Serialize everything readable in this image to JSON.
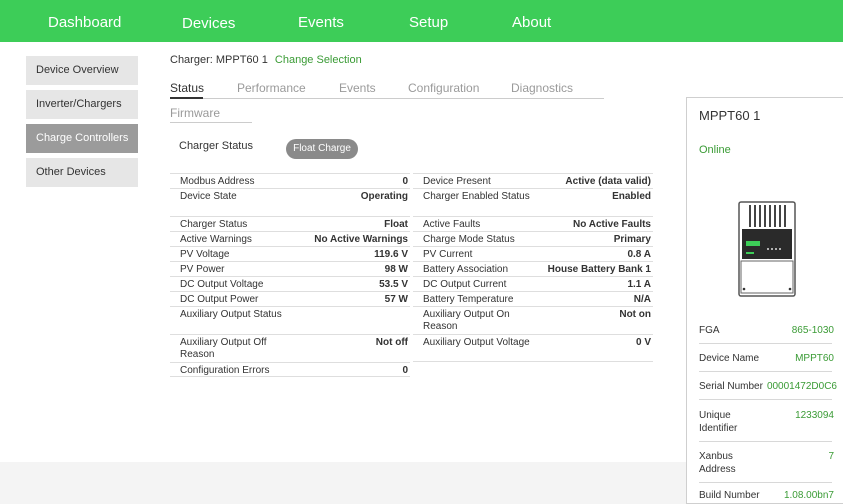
{
  "nav": [
    "Dashboard",
    "Devices",
    "Events",
    "Setup",
    "About"
  ],
  "nav_active": "Devices",
  "sidebar": [
    {
      "label": "Device Overview"
    },
    {
      "label": "Inverter/Chargers"
    },
    {
      "label": "Charge Controllers",
      "active": true
    },
    {
      "label": "Other Devices"
    }
  ],
  "header": {
    "charger_label": "Charger: MPPT60 1",
    "change_link": "Change Selection"
  },
  "tabs": [
    "Status",
    "Performance",
    "Events",
    "Configuration",
    "Diagnostics",
    "Firmware"
  ],
  "active_tab": "Status",
  "charger_status": {
    "label": "Charger Status",
    "badge": "Float Charge"
  },
  "left_rows": [
    {
      "k": "Modbus Address",
      "v": "0"
    },
    {
      "k": "Device State",
      "v": "Operating"
    },
    {
      "k": "Charger Status",
      "v": "Float"
    },
    {
      "k": "Active Warnings",
      "v": "No Active Warnings"
    },
    {
      "k": "PV Voltage",
      "v": "119.6 V"
    },
    {
      "k": "PV Power",
      "v": "98 W"
    },
    {
      "k": "DC Output Voltage",
      "v": "53.5 V"
    },
    {
      "k": "DC Output Power",
      "v": "57 W"
    },
    {
      "k": "Auxiliary Output Status",
      "v": ""
    },
    {
      "k": "Auxiliary Output Off Reason",
      "v": "Not off"
    },
    {
      "k": "Configuration Errors",
      "v": "0"
    }
  ],
  "right_rows": [
    {
      "k": "Device Present",
      "v": "Active (data valid)"
    },
    {
      "k": "Charger Enabled Status",
      "v": "Enabled"
    },
    {
      "k": "Active Faults",
      "v": "No Active Faults"
    },
    {
      "k": "Charge Mode Status",
      "v": "Primary"
    },
    {
      "k": "PV Current",
      "v": "0.8 A"
    },
    {
      "k": "Battery Association",
      "v": "House Battery Bank 1"
    },
    {
      "k": "DC Output Current",
      "v": "1.1 A"
    },
    {
      "k": "Battery Temperature",
      "v": "N/A"
    },
    {
      "k": "Auxiliary Output On Reason",
      "v": "Not on"
    },
    {
      "k": "Auxiliary Output Voltage",
      "v": "0 V"
    }
  ],
  "panel": {
    "model": "MPPT60 1",
    "status": "Online",
    "props": [
      {
        "k": "FGA",
        "v": "865-1030"
      },
      {
        "k": "Device Name",
        "v": "MPPT60"
      },
      {
        "k": "Serial Number",
        "v": "00001472D0C6"
      },
      {
        "k": "Unique Identifier",
        "v": "1233094"
      },
      {
        "k": "Xanbus Address",
        "v": "7"
      },
      {
        "k": "Build Number",
        "v": "1.08.00bn7"
      }
    ]
  },
  "colors": {
    "brand": "#3dcd58",
    "link": "#3a9b35",
    "badge": "#8a8a8a",
    "sidebar_active": "#9b9b9b"
  }
}
